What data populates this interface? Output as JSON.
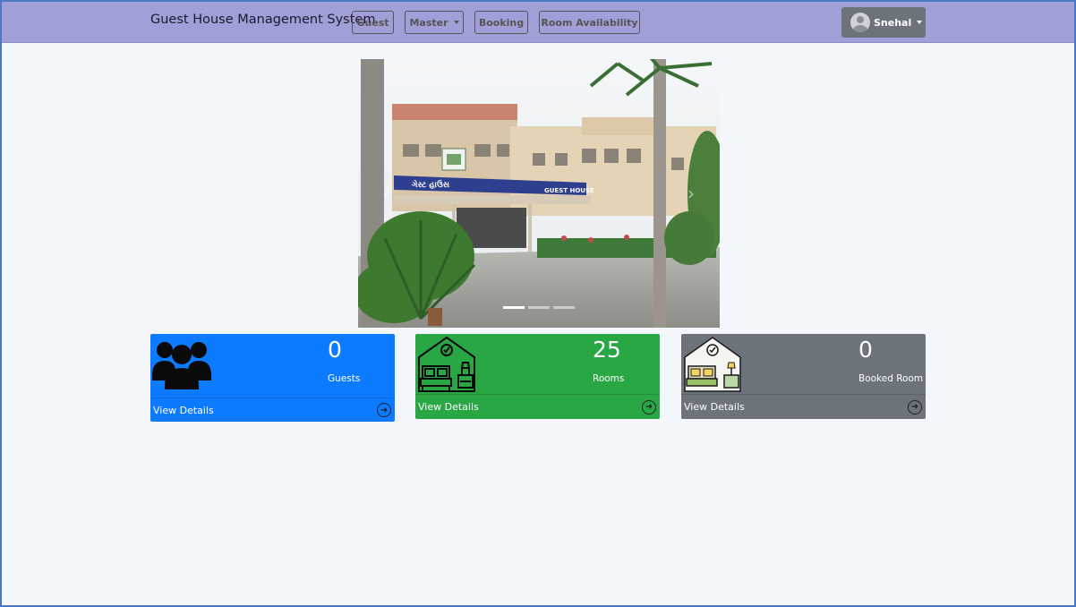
{
  "navbar": {
    "brand": "Guest House Management System",
    "items": [
      {
        "label": "Guest"
      },
      {
        "label": "Master"
      },
      {
        "label": "Booking"
      },
      {
        "label": "Room Availability"
      }
    ],
    "user": {
      "name": "Snehal"
    }
  },
  "carousel": {
    "signboard_text": "GUEST HOUSE",
    "slide_count": 3,
    "active_slide": 1
  },
  "cards": [
    {
      "count": "0",
      "label": "Guests",
      "link": "View Details",
      "color": "#0d7bff",
      "icon": "group-icon"
    },
    {
      "count": "25",
      "label": "Rooms",
      "link": "View Details",
      "color": "#29a745",
      "icon": "bedroom-icon"
    },
    {
      "count": "0",
      "label": "Booked Room",
      "link": "View Details",
      "color": "#6c737a",
      "icon": "booked-room-icon"
    }
  ]
}
